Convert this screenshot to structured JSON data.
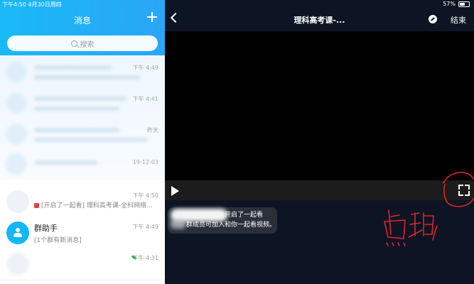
{
  "status_bar": {
    "time_date": "下午4:50  4月30日周四",
    "battery": "57%",
    "battery_level": 0.57
  },
  "left": {
    "title": "消息",
    "search_placeholder": "搜索",
    "blurred_times": [
      "下午 4:49",
      "下午 4:41",
      "昨天",
      "19-12-03"
    ],
    "chats": [
      {
        "time": "下午 4:50",
        "preview": "[开启了一起看] 理科高考课-全科网络..."
      },
      {
        "name": "群助手",
        "time": "下午 4:49",
        "preview": "[1个群有新消息]"
      },
      {
        "time": "下午 4:31"
      }
    ]
  },
  "right": {
    "title": "理科高考课-...",
    "end_label": "结束",
    "notification": {
      "line1": "开启了一起看",
      "line2": "群成员可加入和你一起看视频。"
    },
    "annotation_text": "点击"
  },
  "colors": {
    "accent": "#19b9f6",
    "video_bg": "#0d1424",
    "annotation": "#e0242a"
  }
}
